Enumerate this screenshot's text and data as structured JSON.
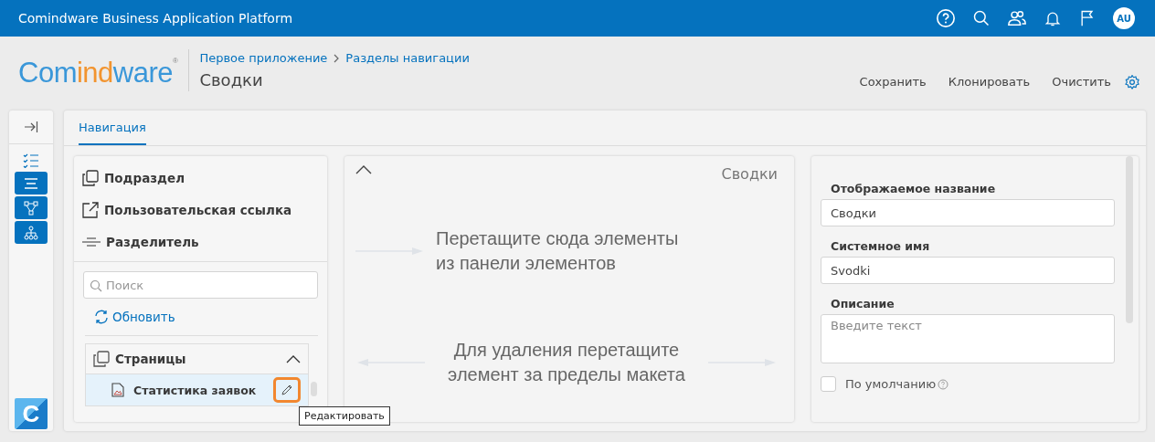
{
  "topbar": {
    "title": "Comindware Business Application Platform",
    "avatar": "AU"
  },
  "header": {
    "logo": [
      {
        "text": "Com",
        "accent": false
      },
      {
        "text": "ind",
        "accent": true
      },
      {
        "text": "ware",
        "accent": false
      }
    ],
    "logo_mark": "®",
    "breadcrumb": [
      "Первое приложение",
      "Разделы навигации"
    ],
    "page_title": "Сводки",
    "actions": [
      "Сохранить",
      "Клонировать",
      "Очистить"
    ]
  },
  "rail": {
    "brand": "C"
  },
  "tabs": [
    {
      "label": "Навигация",
      "selected": true
    }
  ],
  "palette": [
    {
      "kind": "subsection",
      "label": "Подраздел"
    },
    {
      "kind": "link",
      "label": "Пользовательская ссылка"
    },
    {
      "kind": "separator",
      "label": "Разделитель"
    }
  ],
  "search": {
    "placeholder": "Поиск"
  },
  "refresh": "Обновить",
  "tree": [
    {
      "label": "Страницы",
      "expanded": true,
      "children": [
        {
          "label": "Статистика заявок",
          "selected": true
        }
      ]
    }
  ],
  "tooltip": "Редактировать",
  "canvas": {
    "title": "Сводки",
    "hint_add": "Перетащите сюда элементы\nиз панели элементов",
    "hint_remove": "Для удаления перетащите\nэлемент за пределы макета"
  },
  "form": {
    "fields": [
      {
        "kind": "input",
        "label": "Отображаемое название",
        "value": "Сводки"
      },
      {
        "kind": "input",
        "label": "Системное имя",
        "value": "Svodki"
      },
      {
        "kind": "textarea",
        "label": "Описание",
        "placeholder": "Введите текст"
      }
    ],
    "default_checkbox": {
      "label": "По умолчанию",
      "checked": false
    }
  }
}
